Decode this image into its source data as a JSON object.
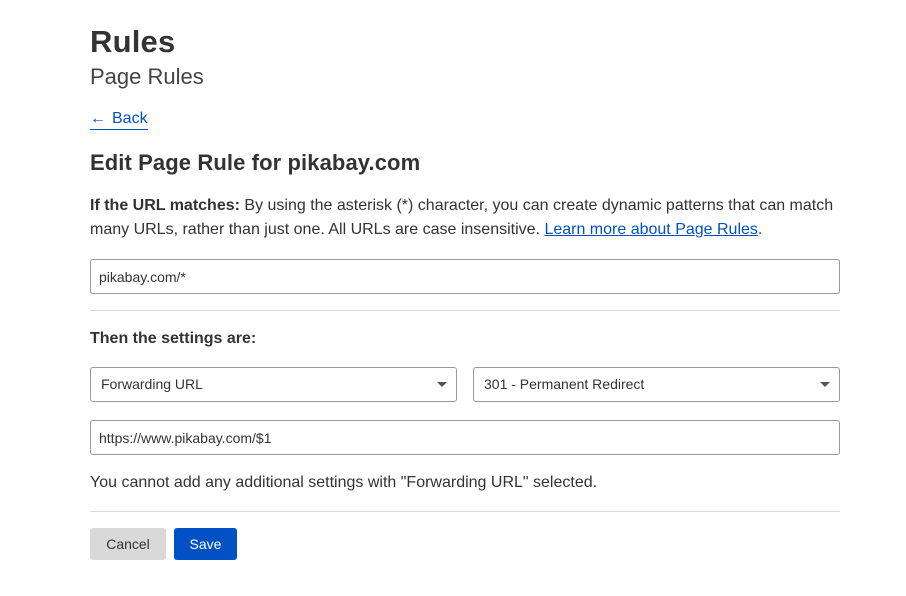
{
  "header": {
    "title": "Rules",
    "subtitle": "Page Rules"
  },
  "nav": {
    "back_label": "Back"
  },
  "form": {
    "heading": "Edit Page Rule for pikabay.com",
    "url_match": {
      "label": "If the URL matches:",
      "description": " By using the asterisk (*) character, you can create dynamic patterns that can match many URLs, rather than just one. All URLs are case insensitive. ",
      "link_text": "Learn more about Page Rules",
      "trailing": ".",
      "value": "pikabay.com/*"
    },
    "settings": {
      "label": "Then the settings are:",
      "setting_select": "Forwarding URL",
      "status_select": "301 - Permanent Redirect",
      "destination_value": "https://www.pikabay.com/$1",
      "note": "You cannot add any additional settings with \"Forwarding URL\" selected."
    },
    "actions": {
      "cancel_label": "Cancel",
      "save_label": "Save"
    }
  },
  "colors": {
    "accent": "#0051c3",
    "cancel_bg": "#d9d9d9"
  }
}
